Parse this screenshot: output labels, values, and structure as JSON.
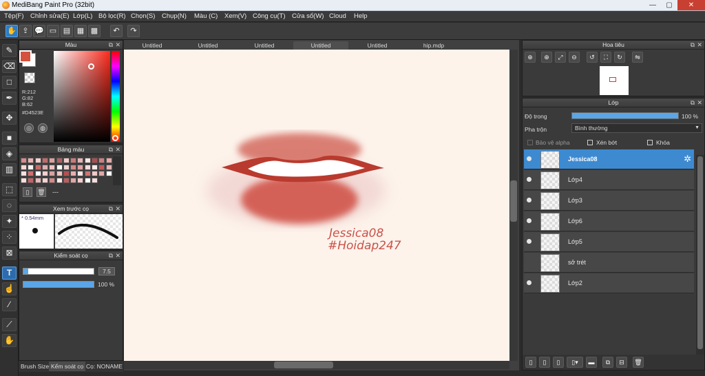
{
  "window": {
    "title": "MediBang Paint Pro (32bit)",
    "minimize": "—",
    "maximize": "▢",
    "close": "✕"
  },
  "menu": [
    "Tệp(F)",
    "Chỉnh sửa(E)",
    "Lớp(L)",
    "Bộ lọc(R)",
    "Chọn(S)",
    "Chụp(N)",
    "Màu (C)",
    "Xem(V)",
    "Công cụ(T)",
    "Cửa sổ(W)",
    "Cloud",
    "Help"
  ],
  "toolbar": {
    "icons": [
      "hand-icon",
      "cloud-upload-icon",
      "chat-icon",
      "comment-icon",
      "page-icon",
      "panel-icon",
      "grid-icon"
    ],
    "undo": "↶",
    "redo": "↷"
  },
  "tools": [
    "brush-icon",
    "eraser-icon",
    "rectangle-icon",
    "pen-icon",
    "move-icon",
    "fill-rect-icon",
    "bucket-icon",
    "gradient-icon",
    "select-icon",
    "lasso-icon",
    "magic-wand-icon",
    "select-pen-icon",
    "select-eraser-icon",
    "text-icon",
    "operation-icon",
    "eyedropper-icon",
    "dropper2-icon",
    "hand-icon"
  ],
  "color_panel": {
    "title": "Màu",
    "r": "R:212",
    "g": "G:82",
    "b": "B:62",
    "hex": "#D4523E",
    "fg": "#D4523E"
  },
  "palette_panel": {
    "title": "Bảng màu",
    "footer": "---",
    "swatches": [
      "#d98b8b",
      "#e9b1b1",
      "#f3d0d0",
      "#c46a6a",
      "#e0a0a0",
      "#b85c5c",
      "#f0c8c8",
      "#d07878",
      "#e6b6b6",
      "#fbe3e3",
      "#b04d4d",
      "#cf7f7f",
      "#e8aaaa",
      "#f6d6d6",
      "#fff0f0",
      "#c96a6a",
      "#ddb0b0",
      "#f0c0c0",
      "#ffffff",
      "#eed0d0",
      "#d58a8a",
      "#e2a0a0",
      "#f7dada",
      "#fde9e9",
      "#c05a5a",
      "#e5b5b5",
      "#f9e0e0",
      "#d07070",
      "#ffffff",
      "#f4cfcf",
      "#dca0a0",
      "#eec4c4",
      "#b55050",
      "#e7b0b0",
      "#fbe6e6",
      "#cc7474",
      "#f1c9c9",
      "#e0a8a8",
      "#ffffff",
      "#f8dede",
      "#c36262",
      "#e8b8b8",
      "#f5d2d2",
      "#d68888",
      "#fde8e8",
      "#bd5e5e",
      "#e3a6a6",
      "#f2caca",
      "#ffffff",
      "#f7dcdc"
    ]
  },
  "brush_preview": {
    "title": "Xem trước cọ",
    "size": "* 0.54mm"
  },
  "brush_control": {
    "title": "Kiểm soát cọ",
    "size_value": "7.5",
    "size_level": 0.07,
    "opacity_value": "100 %",
    "opacity_level": 1.0
  },
  "bottom_tabs": {
    "brush_size": "Brush Size",
    "brush_control": "Kểm soát cọ",
    "brush_name": "Cọ: NONAME"
  },
  "doc_tabs": [
    "Untitled",
    "Untitled",
    "Untitled",
    "Untitled",
    "Untitled",
    "hip.mdp"
  ],
  "canvas": {
    "signature": "Jessica08",
    "watermark": "#Hoidap247"
  },
  "navigator": {
    "title": "Hoa tiêu"
  },
  "layer_panel": {
    "title": "Lớp",
    "opacity_label": "Độ trong",
    "opacity_value": "100 %",
    "opacity_level": 1.0,
    "blend_label": "Pha trộn",
    "blend_value": "Bình thường",
    "protect_alpha": "Bảo vệ alpha",
    "clipping": "Xén bớt",
    "lock": "Khóa",
    "layers": [
      {
        "name": "Jessica08",
        "visible": true
      },
      {
        "name": "Lớp4",
        "visible": true
      },
      {
        "name": "Lớp3",
        "visible": true
      },
      {
        "name": "Lớp6",
        "visible": true
      },
      {
        "name": "Lớp5",
        "visible": true
      },
      {
        "name": "sở trét",
        "visible": false
      },
      {
        "name": "Lớp2",
        "visible": true
      }
    ]
  }
}
